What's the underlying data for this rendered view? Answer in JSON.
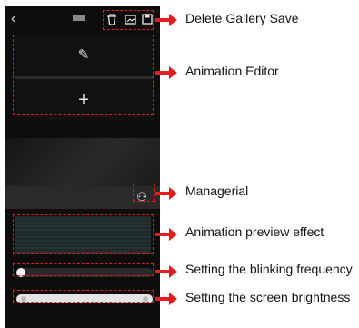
{
  "phone": {
    "back_icon": "chevron-left-icon",
    "toolbar_icons": [
      "trash-icon",
      "gallery-icon",
      "save-icon"
    ],
    "glyphs": {
      "pencil": "✎",
      "plus": "+",
      "managerial": "⚇",
      "back": "‹"
    },
    "blink_frequency_fraction": 0.03,
    "brightness_fraction": 0.97
  },
  "callouts": {
    "toolbar": "Delete Gallery Save",
    "editor": "Animation Editor",
    "managerial": "Managerial",
    "preview": "Animation preview effect",
    "blink": "Setting the blinking frequency",
    "brightness": "Setting the screen brightness"
  },
  "colors": {
    "annotation": "#e0201f",
    "screen": "#0d0d0d"
  }
}
